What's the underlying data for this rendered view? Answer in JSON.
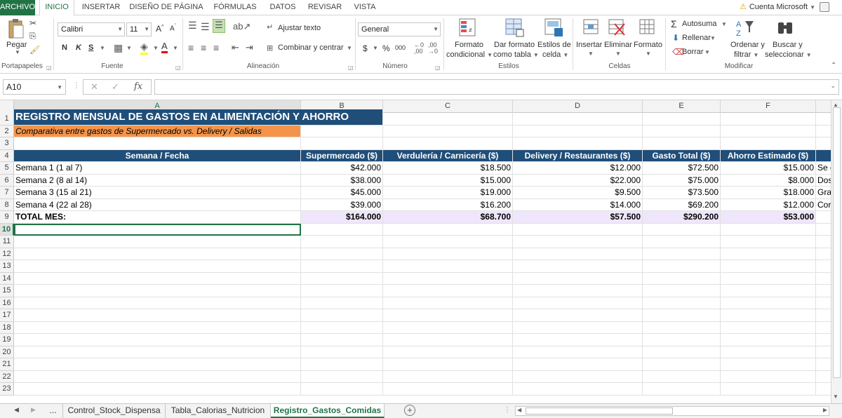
{
  "ribbon_tabs": [
    "ARCHIVO",
    "INICIO",
    "INSERTAR",
    "DISEÑO DE PÁGINA",
    "FÓRMULAS",
    "DATOS",
    "REVISAR",
    "VISTA"
  ],
  "account": "Cuenta Microsoft",
  "clipboard": {
    "paste": "Pegar",
    "label": "Portapapeles"
  },
  "font": {
    "name": "Calibri",
    "size": "11",
    "bold": "N",
    "italic": "K",
    "underline": "S",
    "label": "Fuente"
  },
  "alignment": {
    "wrap": "Ajustar texto",
    "merge": "Combinar y centrar",
    "label": "Alineación"
  },
  "number": {
    "format": "General",
    "currency": "$",
    "percent": "%",
    "thousands": "000",
    "label": "Número"
  },
  "styles": {
    "conditional_1": "Formato",
    "conditional_2": "condicional",
    "table_1": "Dar formato",
    "table_2": "como tabla",
    "cell_1": "Estilos de",
    "cell_2": "celda",
    "label": "Estilos"
  },
  "cells": {
    "insert": "Insertar",
    "delete": "Eliminar",
    "format": "Formato",
    "label": "Celdas"
  },
  "editing": {
    "autosum": "Autosuma",
    "fill": "Rellenar",
    "clear": "Borrar",
    "sort_1": "Ordenar y",
    "sort_2": "filtrar",
    "find_1": "Buscar y",
    "find_2": "seleccionar",
    "label": "Modificar"
  },
  "name_box": "A10",
  "formula_value": "",
  "columns": [
    "A",
    "B",
    "C",
    "D",
    "E",
    "F"
  ],
  "rows_count": 23,
  "sheet": {
    "title": "REGISTRO MENSUAL DE GASTOS EN ALIMENTACIÓN Y AHORRO",
    "subtitle": "Comparativa entre gastos de Supermercado vs. Delivery / Salidas",
    "headers": [
      "Semana / Fecha",
      "Supermercado ($)",
      "Verdulería / Carnicería ($)",
      "Delivery / Restaurantes ($)",
      "Gasto Total ($)",
      "Ahorro Estimado ($)"
    ],
    "data": [
      [
        "Semana 1 (1 al 7)",
        "$42.000",
        "$18.500",
        "$12.000",
        "$72.500",
        "$15.000",
        "Se c"
      ],
      [
        "Semana 2 (8 al 14)",
        "$38.000",
        "$15.000",
        "$22.000",
        "$75.000",
        "$8.000",
        "Dos"
      ],
      [
        "Semana 3 (15 al 21)",
        "$45.000",
        "$19.000",
        "$9.500",
        "$73.500",
        "$18.000",
        "Gra"
      ],
      [
        "Semana 4 (22 al 28)",
        "$39.000",
        "$16.200",
        "$14.000",
        "$69.200",
        "$12.000",
        "Cor"
      ]
    ],
    "total": [
      "TOTAL MES:",
      "$164.000",
      "$68.700",
      "$57.500",
      "$290.200",
      "$53.000"
    ]
  },
  "sheet_tabs": [
    "...",
    "Control_Stock_Dispensa",
    "Tabla_Calorias_Nutricion",
    "Registro_Gastos_Comidas"
  ],
  "active_sheet": "Registro_Gastos_Comidas",
  "colors": {
    "excel_green": "#217346",
    "title_bg": "#1f4e79",
    "subtitle_bg": "#f4944a",
    "header_bg": "#1f4e79",
    "total_bg": "#efe6fb"
  }
}
